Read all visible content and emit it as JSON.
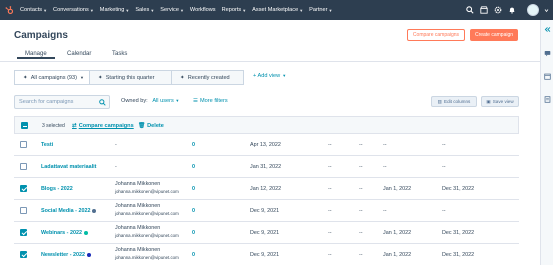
{
  "nav": {
    "items": [
      {
        "label": "Contacts",
        "caret": true
      },
      {
        "label": "Conversations",
        "caret": true
      },
      {
        "label": "Marketing",
        "caret": true
      },
      {
        "label": "Sales",
        "caret": true
      },
      {
        "label": "Service",
        "caret": true
      },
      {
        "label": "Workflows",
        "caret": false
      },
      {
        "label": "Reports",
        "caret": true
      },
      {
        "label": "Asset Marketplace",
        "caret": true
      },
      {
        "label": "Partner",
        "caret": true
      }
    ]
  },
  "page": {
    "title": "Campaigns",
    "compare_button": "Compare campaigns",
    "create_button": "Create campaign",
    "tabs": [
      "Manage",
      "Calendar",
      "Tasks"
    ]
  },
  "views": {
    "items": [
      "All campaigns (93)",
      "Starting this quarter",
      "Recently created"
    ],
    "add_view": "Add view"
  },
  "filters": {
    "search_placeholder": "Search for campaigns",
    "owned_by_label": "Owned by:",
    "owned_by_value": "All users",
    "more_filters": "More filters",
    "edit_columns": "Edit columns",
    "save_view": "Save view"
  },
  "bulk": {
    "selected": "3 selected",
    "compare": "Compare campaigns",
    "delete": "Delete"
  },
  "rows": [
    {
      "name": "Testi",
      "owner": "-",
      "email": "",
      "count": "0",
      "created": "Apr 13, 2022",
      "c1": "--",
      "c2": "--",
      "start": "--",
      "end": "--",
      "checked": false,
      "dot": ""
    },
    {
      "name": "Ladattavat materiaalit",
      "owner": "-",
      "email": "",
      "count": "0",
      "created": "Jan 31, 2022",
      "c1": "--",
      "c2": "--",
      "start": "--",
      "end": "--",
      "checked": false,
      "dot": ""
    },
    {
      "name": "Blogs - 2022",
      "owner": "Johanna Mikkonen",
      "email": "johanna.mikkonen@vipunet.com",
      "count": "0",
      "created": "Jan 12, 2022",
      "c1": "--",
      "c2": "--",
      "start": "Jan 1, 2022",
      "end": "Dec 31, 2022",
      "checked": true,
      "dot": ""
    },
    {
      "name": "Social Media - 2022",
      "owner": "Johanna Mikkonen",
      "email": "johanna.mikkonen@vipunet.com",
      "count": "0",
      "created": "Dec 9, 2021",
      "c1": "--",
      "c2": "--",
      "start": "--",
      "end": "--",
      "checked": false,
      "dot": "#516f90"
    },
    {
      "name": "Webinars - 2022",
      "owner": "Johanna Mikkonen",
      "email": "johanna.mikkonen@vipunet.com",
      "count": "0",
      "created": "Dec 9, 2021",
      "c1": "--",
      "c2": "--",
      "start": "Jan 1, 2022",
      "end": "Dec 31, 2022",
      "checked": true,
      "dot": "#00bda5"
    },
    {
      "name": "Newsletter - 2022",
      "owner": "Johanna Mikkonen",
      "email": "johanna.mikkonen@vipunet.com",
      "count": "0",
      "created": "Dec 9, 2021",
      "c1": "--",
      "c2": "--",
      "start": "Jan 1, 2022",
      "end": "Dec 31, 2022",
      "checked": true,
      "dot": "#1a2bb8"
    }
  ],
  "colors": {
    "brand": "#ff7a59",
    "nav_bg": "#2d3e50",
    "link": "#0091ae"
  }
}
